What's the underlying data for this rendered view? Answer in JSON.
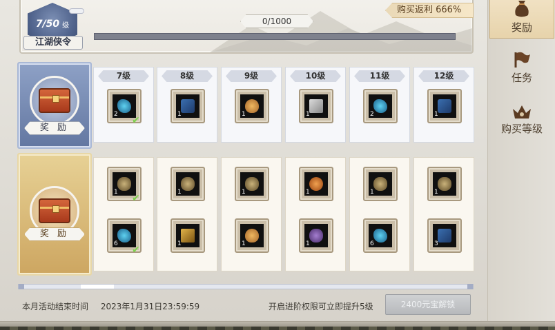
{
  "header": {
    "level": "7/50",
    "level_unit": "级",
    "pass_name": "江湖侠令",
    "exp_text": "0/1000",
    "exp_progress": 0,
    "rebate_label": "购买返利 666%"
  },
  "side_tabs": [
    {
      "label": "奖励",
      "icon": "money-bag-icon",
      "active": true
    },
    {
      "label": "任务",
      "icon": "flag-icon",
      "active": false
    },
    {
      "label": "购买等级",
      "icon": "crown-icon",
      "active": false
    }
  ],
  "free_row": {
    "label": "奖 励",
    "chest_icon": "red-chest-icon"
  },
  "paid_row": {
    "label": "奖 励",
    "chest_icon": "golden-chest-icon"
  },
  "columns": [
    {
      "level": "7级",
      "free": {
        "icon": "blue-gem-icon",
        "count": "2",
        "claimed": true
      },
      "paid": [
        {
          "icon": "gold-bags-icon",
          "count": "1",
          "claimed": true
        },
        {
          "icon": "blue-gem-icon",
          "count": "6",
          "claimed": true
        }
      ]
    },
    {
      "level": "8级",
      "free": {
        "icon": "blue-scroll-icon",
        "count": "1",
        "claimed": false
      },
      "paid": [
        {
          "icon": "gold-bags-icon",
          "count": "1",
          "claimed": false
        },
        {
          "icon": "gold-scroll-icon",
          "count": "1",
          "claimed": false
        }
      ]
    },
    {
      "level": "9级",
      "free": {
        "icon": "bread-icon",
        "count": "1",
        "claimed": false
      },
      "paid": [
        {
          "icon": "gold-bags-icon",
          "count": "1",
          "claimed": false
        },
        {
          "icon": "bread-icon",
          "count": "1",
          "claimed": false
        }
      ]
    },
    {
      "level": "10级",
      "free": {
        "icon": "book-icon",
        "count": "1",
        "claimed": false
      },
      "paid": [
        {
          "icon": "orange-pouch-icon",
          "count": "1",
          "claimed": false
        },
        {
          "icon": "purple-bag-icon",
          "count": "1",
          "claimed": false
        }
      ]
    },
    {
      "level": "11级",
      "free": {
        "icon": "blue-gem-icon",
        "count": "2",
        "claimed": false
      },
      "paid": [
        {
          "icon": "gold-bags-icon",
          "count": "1",
          "claimed": false
        },
        {
          "icon": "blue-gem-icon",
          "count": "6",
          "claimed": false
        }
      ]
    },
    {
      "level": "12级",
      "free": {
        "icon": "blue-scroll-icon",
        "count": "1",
        "claimed": false
      },
      "paid": [
        {
          "icon": "gold-bags-icon",
          "count": "1",
          "claimed": false
        },
        {
          "icon": "blue-scroll-icon",
          "count": "3",
          "claimed": false
        }
      ]
    }
  ],
  "footer": {
    "end_label": "本月活动结束时间",
    "end_time": "2023年1月31日23:59:59",
    "hint": "开启进阶权限可立即提升5级",
    "unlock_button": "2400元宝解锁"
  },
  "colors": {
    "free_header": "#7184ad",
    "paid_header": "#d9b979",
    "exp_bar": "#7e818d",
    "check": "#7bd14c"
  }
}
